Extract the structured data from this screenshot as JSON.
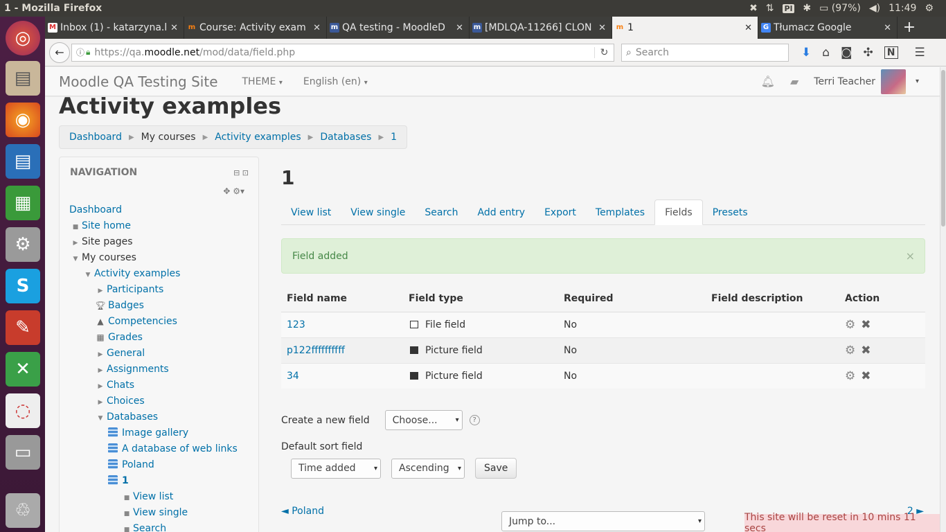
{
  "os": {
    "window_title": "1 - Mozilla Firefox",
    "indicators": {
      "keyboard": "Pl",
      "battery": "(97%)",
      "clock": "11:49"
    }
  },
  "browser": {
    "tabs": [
      {
        "label": "Inbox (1) - katarzyna.k",
        "favicon": "gmail-icon",
        "active": false
      },
      {
        "label": "Course: Activity exam",
        "favicon": "moodle-icon",
        "active": false
      },
      {
        "label": "QA testing - MoodleD",
        "favicon": "moodle-tracker-icon",
        "active": false
      },
      {
        "label": "[MDLQA-11266] CLON",
        "favicon": "moodle-tracker-icon",
        "active": false
      },
      {
        "label": "1",
        "favicon": "moodle-icon",
        "active": true
      },
      {
        "label": "Tłumacz Google",
        "favicon": "google-translate-icon",
        "active": false
      }
    ],
    "url_prefix": "https://qa.",
    "url_host": "moodle.net",
    "url_path": "/mod/data/field.php",
    "search_placeholder": "Search"
  },
  "moodle_nav": {
    "site_name": "Moodle QA Testing Site",
    "theme_menu": "THEME",
    "language_menu": "English (en)",
    "user_name": "Terri Teacher"
  },
  "page": {
    "heading": "Activity examples",
    "breadcrumb": [
      "Dashboard",
      "My courses",
      "Activity examples",
      "Databases",
      "1"
    ]
  },
  "navigation_block": {
    "title": "NAVIGATION",
    "items": [
      {
        "label": "Dashboard"
      },
      {
        "label": "Site home"
      },
      {
        "label": "Site pages"
      },
      {
        "label": "My courses"
      },
      {
        "label": "Activity examples"
      },
      {
        "label": "Participants"
      },
      {
        "label": "Badges"
      },
      {
        "label": "Competencies"
      },
      {
        "label": "Grades"
      },
      {
        "label": "General"
      },
      {
        "label": "Assignments"
      },
      {
        "label": "Chats"
      },
      {
        "label": "Choices"
      },
      {
        "label": "Databases"
      },
      {
        "label": "Image gallery"
      },
      {
        "label": "A database of web links"
      },
      {
        "label": "Poland"
      },
      {
        "label": "1"
      },
      {
        "label": "View list"
      },
      {
        "label": "View single"
      },
      {
        "label": "Search"
      }
    ]
  },
  "main": {
    "title": "1",
    "tabs": [
      "View list",
      "View single",
      "Search",
      "Add entry",
      "Export",
      "Templates",
      "Fields",
      "Presets"
    ],
    "active_tab": "Fields",
    "alert": "Field added",
    "alert_close": "×",
    "table": {
      "headers": [
        "Field name",
        "Field type",
        "Required",
        "Field description",
        "Action"
      ],
      "rows": [
        {
          "name": "123",
          "type": "File field",
          "type_icon": "folder-icon",
          "required": "No",
          "description": ""
        },
        {
          "name": "p122ffffffffff",
          "type": "Picture field",
          "type_icon": "picture-icon",
          "required": "No",
          "description": ""
        },
        {
          "name": "34",
          "type": "Picture field",
          "type_icon": "picture-icon",
          "required": "No",
          "description": ""
        }
      ]
    },
    "create_label": "Create a new field",
    "create_select": "Choose...",
    "sort_label": "Default sort field",
    "sort_field": "Time added",
    "sort_order": "Ascending",
    "save_button": "Save",
    "prev_link": "◄ Poland",
    "next_link": "2 ►",
    "jump_to": "Jump to...",
    "reset_notice": "This site will be reset in 10 mins 11 secs"
  }
}
